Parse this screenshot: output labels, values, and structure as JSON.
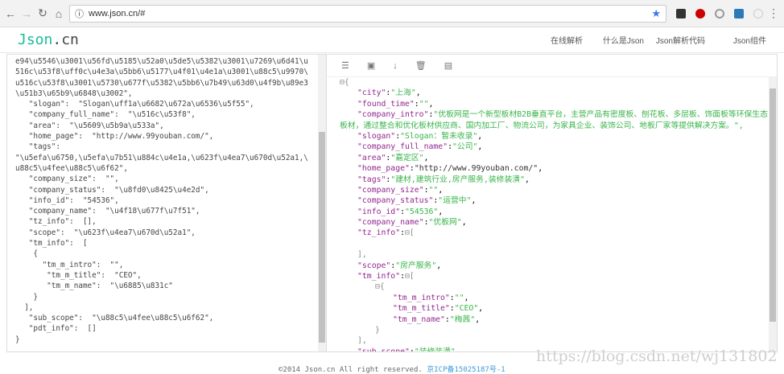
{
  "browser": {
    "url": "www.json.cn/#"
  },
  "site": {
    "logo_main": "Json",
    "logo_ext": ".cn",
    "menu": [
      "在线解析",
      "什么是Json",
      "Json解析代码",
      "Json组件"
    ]
  },
  "left_lines": [
    "e94\\u5546\\u3001\\u56fd\\u5185\\u52a0\\u5de5\\u5382\\u3001\\u7269\\u6d41\\u",
    "516c\\u53f8\\uff0c\\u4e3a\\u5bb6\\u5177\\u4f01\\u4e1a\\u3001\\u88c5\\u9970\\",
    "u516c\\u53f8\\u3001\\u5730\\u677f\\u5382\\u5bb6\\u7b49\\u63d0\\u4f9b\\u89e3",
    "\\u51b3\\u65b9\\u6848\\u3002\",",
    "   \"slogan\":  \"Slogan\\uff1a\\u6682\\u672a\\u6536\\u5f55\",",
    "   \"company_full_name\":  \"\\u516c\\u53f8\",",
    "   \"area\":  \"\\u5609\\u5b9a\\u533a\",",
    "   \"home_page\":  \"http://www.99youban.com/\",",
    "   \"tags\":",
    "\"\\u5efa\\u6750,\\u5efa\\u7b51\\u884c\\u4e1a,\\u623f\\u4ea7\\u670d\\u52a1,\\",
    "u88c5\\u4fee\\u88c5\\u6f62\",",
    "   \"company_size\":  \"\",",
    "   \"company_status\":  \"\\u8fd0\\u8425\\u4e2d\",",
    "   \"info_id\":  \"54536\",",
    "   \"company_name\":  \"\\u4f18\\u677f\\u7f51\",",
    "   \"tz_info\":  [],",
    "   \"scope\":  \"\\u623f\\u4ea7\\u670d\\u52a1\",",
    "   \"tm_info\":  [",
    "    {",
    "      \"tm_m_intro\":  \"\",",
    "       \"tm_m_title\":  \"CEO\",",
    "       \"tm_m_name\":  \"\\u6885\\u831c\"",
    "    }",
    "  ],",
    "   \"sub_scope\":  \"\\u88c5\\u4fee\\u88c5\\u6f62\",",
    "   \"pdt_info\":  []",
    "}"
  ],
  "toolbar_icons": [
    "database-icon",
    "excel-icon",
    "sort-icon",
    "trash-icon",
    "save-icon"
  ],
  "tree": [
    {
      "i": 0,
      "p": "⊟{"
    },
    {
      "i": 1,
      "k": "city",
      "v": "上海"
    },
    {
      "i": 1,
      "k": "found_time",
      "v": ""
    },
    {
      "i": 1,
      "k": "company_intro",
      "v": "优板网是一个新型板材B2B垂直平台，主营产品有密度板、刨花板、多层板、饰面板等环保生态"
    },
    {
      "i": -1,
      "v2": "板材，通过整合和优化板材供应商、国内加工厂、物流公司，为家具企业、装饰公司、地板厂家等提供解决方案。"
    },
    {
      "i": 1,
      "k": "slogan",
      "v": "Slogan：暂未收录"
    },
    {
      "i": 1,
      "k": "company_full_name",
      "v": "公司"
    },
    {
      "i": 1,
      "k": "area",
      "v": "嘉定区"
    },
    {
      "i": 1,
      "k": "home_page",
      "v": "http://www.99youban.com/",
      "url": true
    },
    {
      "i": 1,
      "k": "tags",
      "v": "建材,建筑行业,房产服务,装修装潢"
    },
    {
      "i": 1,
      "k": "company_size",
      "v": ""
    },
    {
      "i": 1,
      "k": "company_status",
      "v": "运营中"
    },
    {
      "i": 1,
      "k": "info_id",
      "v": "54536"
    },
    {
      "i": 1,
      "k": "company_name",
      "v": "优板网"
    },
    {
      "i": 1,
      "k": "tz_info",
      "o": "⊟["
    },
    {
      "i": 1,
      "p": ""
    },
    {
      "i": 1,
      "p": "],"
    },
    {
      "i": 1,
      "k": "scope",
      "v": "房产服务"
    },
    {
      "i": 1,
      "k": "tm_info",
      "o": "⊟["
    },
    {
      "i": 2,
      "p": "⊟{"
    },
    {
      "i": 3,
      "k": "tm_m_intro",
      "v": ""
    },
    {
      "i": 3,
      "k": "tm_m_title",
      "v": "CEO"
    },
    {
      "i": 3,
      "k": "tm_m_name",
      "v": "梅茜"
    },
    {
      "i": 2,
      "p": "}"
    },
    {
      "i": 1,
      "p": "],"
    },
    {
      "i": 1,
      "k": "sub_scope",
      "v": "装修装潢"
    }
  ],
  "footer": {
    "copyright": "©2014 Json.cn All right reserved.",
    "icp": "京ICP备15025187号-1"
  },
  "watermark": "https://blog.csdn.net/wj131802"
}
